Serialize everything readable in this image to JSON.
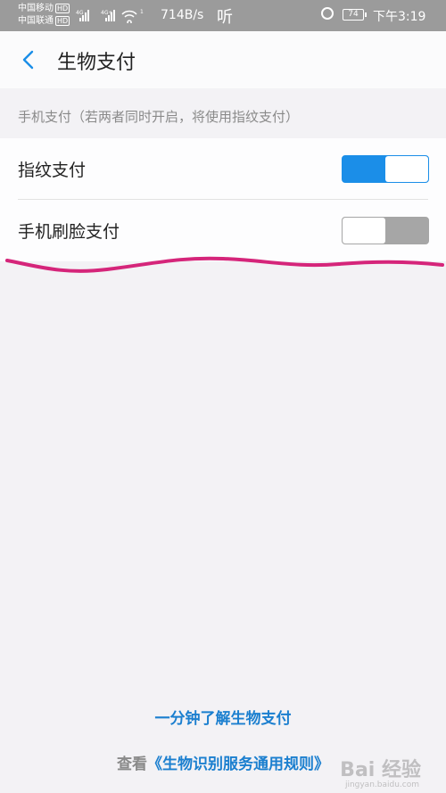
{
  "status_bar": {
    "carrier_1": "中国移动",
    "carrier_2": "中国联通",
    "hd_badge": "HD",
    "net_speed": "714B/s",
    "audio_glyph": "听",
    "battery": "74",
    "time": "下午3:19",
    "icons": [
      "signal-icon",
      "wifi-icon",
      "alarm-icon",
      "battery-icon"
    ]
  },
  "header": {
    "title": "生物支付",
    "back_icon": "chevron-left-icon"
  },
  "section": {
    "label": "手机支付（若两者同时开启，将使用指纹支付）"
  },
  "settings": [
    {
      "label": "指纹支付",
      "enabled": true
    },
    {
      "label": "手机刷脸支付",
      "enabled": false
    }
  ],
  "footer": {
    "learn_link": "一分钟了解生物支付",
    "rules_prefix": "查看",
    "rules_link": "《生物识别服务通用规则》"
  },
  "watermark": {
    "text": "Bai 经验",
    "sub": "jingyan.baidu.com"
  },
  "colors": {
    "accent": "#1b8ee8",
    "link": "#1b7fcf",
    "annotation": "#d5257a",
    "toggle_off": "#a6a6a6"
  }
}
